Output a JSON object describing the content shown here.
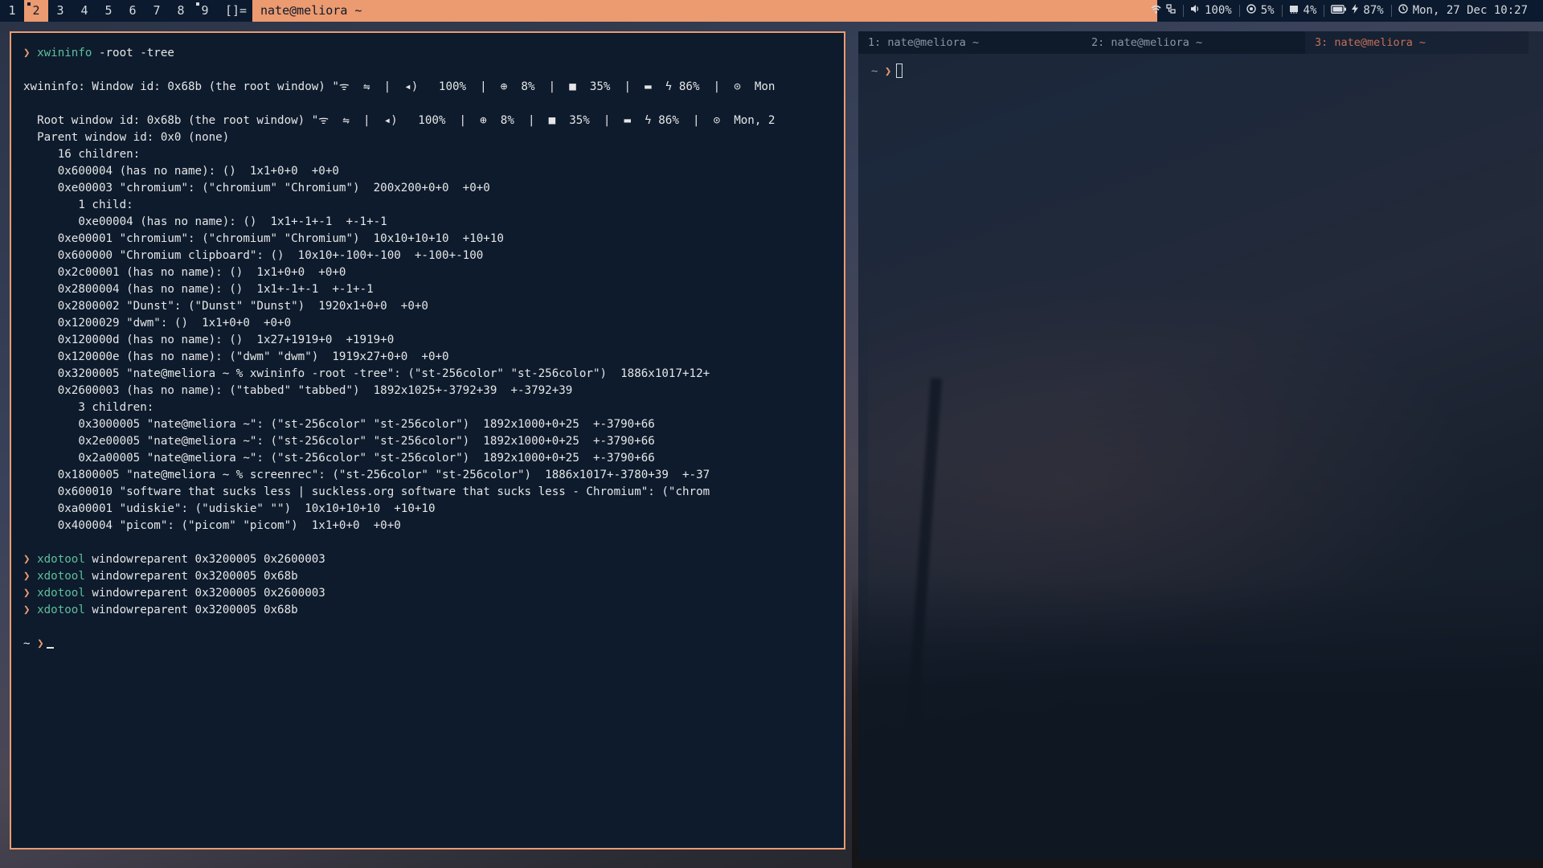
{
  "bar": {
    "tags": [
      "1",
      "2",
      "3",
      "4",
      "5",
      "6",
      "7",
      "8",
      "9"
    ],
    "selected_tag": 1,
    "occupied_tags": [
      1,
      8
    ],
    "layout": "[]=",
    "window_title": "nate@meliora ~",
    "status": {
      "volume": "100%",
      "cpu": "5%",
      "mem": "4%",
      "battery": "87%",
      "clock": "Mon, 27 Dec 10:27"
    }
  },
  "left_terminal": {
    "lines": [
      {
        "prompt": "❯ ",
        "cmd": "xwininfo",
        "args": " -root -tree"
      },
      {
        "text": ""
      },
      {
        "text": "xwininfo: Window id: 0x68b (the root window) \"ᯤ  ⇋  |  ◂)   100%  |  ⊕  8%  |  ■  35%  |  ▬  ϟ 86%  |  ⊙  Mon"
      },
      {
        "text": ""
      },
      {
        "text": "  Root window id: 0x68b (the root window) \"ᯤ  ⇋  |  ◂)   100%  |  ⊕  8%  |  ■  35%  |  ▬  ϟ 86%  |  ⊙  Mon, 2"
      },
      {
        "text": "  Parent window id: 0x0 (none)"
      },
      {
        "text": "     16 children:"
      },
      {
        "text": "     0x600004 (has no name): ()  1x1+0+0  +0+0"
      },
      {
        "text": "     0xe00003 \"chromium\": (\"chromium\" \"Chromium\")  200x200+0+0  +0+0"
      },
      {
        "text": "        1 child:"
      },
      {
        "text": "        0xe00004 (has no name): ()  1x1+-1+-1  +-1+-1"
      },
      {
        "text": "     0xe00001 \"chromium\": (\"chromium\" \"Chromium\")  10x10+10+10  +10+10"
      },
      {
        "text": "     0x600000 \"Chromium clipboard\": ()  10x10+-100+-100  +-100+-100"
      },
      {
        "text": "     0x2c00001 (has no name): ()  1x1+0+0  +0+0"
      },
      {
        "text": "     0x2800004 (has no name): ()  1x1+-1+-1  +-1+-1"
      },
      {
        "text": "     0x2800002 \"Dunst\": (\"Dunst\" \"Dunst\")  1920x1+0+0  +0+0"
      },
      {
        "text": "     0x1200029 \"dwm\": ()  1x1+0+0  +0+0"
      },
      {
        "text": "     0x120000d (has no name): ()  1x27+1919+0  +1919+0"
      },
      {
        "text": "     0x120000e (has no name): (\"dwm\" \"dwm\")  1919x27+0+0  +0+0"
      },
      {
        "text": "     0x3200005 \"nate@meliora ~ % xwininfo -root -tree\": (\"st-256color\" \"st-256color\")  1886x1017+12+"
      },
      {
        "text": "     0x2600003 (has no name): (\"tabbed\" \"tabbed\")  1892x1025+-3792+39  +-3792+39"
      },
      {
        "text": "        3 children:"
      },
      {
        "text": "        0x3000005 \"nate@meliora ~\": (\"st-256color\" \"st-256color\")  1892x1000+0+25  +-3790+66"
      },
      {
        "text": "        0x2e00005 \"nate@meliora ~\": (\"st-256color\" \"st-256color\")  1892x1000+0+25  +-3790+66"
      },
      {
        "text": "        0x2a00005 \"nate@meliora ~\": (\"st-256color\" \"st-256color\")  1892x1000+0+25  +-3790+66"
      },
      {
        "text": "     0x1800005 \"nate@meliora ~ % screenrec\": (\"st-256color\" \"st-256color\")  1886x1017+-3780+39  +-37"
      },
      {
        "text": "     0x600010 \"software that sucks less | suckless.org software that sucks less - Chromium\": (\"chrom"
      },
      {
        "text": "     0xa00001 \"udiskie\": (\"udiskie\" \"\")  10x10+10+10  +10+10"
      },
      {
        "text": "     0x400004 \"picom\": (\"picom\" \"picom\")  1x1+0+0  +0+0"
      },
      {
        "text": ""
      },
      {
        "prompt": "❯ ",
        "cmd": "xdotool",
        "args": " windowreparent 0x3200005 0x2600003"
      },
      {
        "prompt": "❯ ",
        "cmd": "xdotool",
        "args": " windowreparent 0x3200005 0x68b"
      },
      {
        "prompt": "❯ ",
        "cmd": "xdotool",
        "args": " windowreparent 0x3200005 0x2600003"
      },
      {
        "prompt": "❯ ",
        "cmd": "xdotool",
        "args": " windowreparent 0x3200005 0x68b"
      },
      {
        "text": ""
      },
      {
        "tilde_prompt": true
      }
    ],
    "final_prompt_dir": "~ ",
    "final_prompt_sym": "❯"
  },
  "right_terminal": {
    "tabs": [
      {
        "label": "1: nate@meliora ~",
        "active": false
      },
      {
        "label": "2: nate@meliora ~",
        "active": false
      },
      {
        "label": "3: nate@meliora ~",
        "active": true
      }
    ],
    "prompt_dir": "~ ",
    "prompt_sym": "❯"
  },
  "colors": {
    "accent": "#ec9a6f",
    "bar_bg": "#0b1a2e",
    "terminal_bg": "#0d1b2d",
    "command": "#5fbf9c"
  }
}
